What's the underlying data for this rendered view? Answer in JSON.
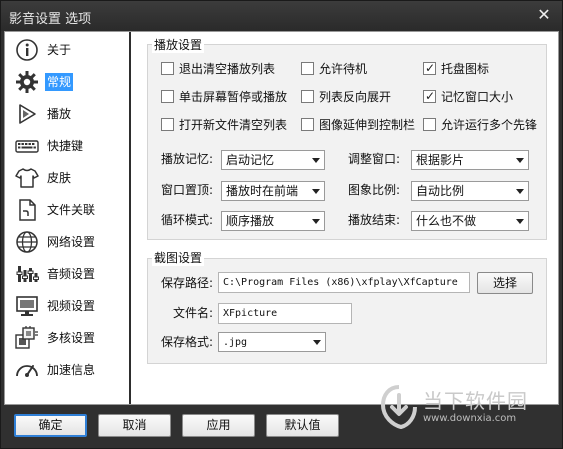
{
  "window": {
    "title": "影音设置 选项",
    "close_glyph": "✕"
  },
  "sidebar": {
    "items": [
      {
        "label": "关于",
        "icon": "info-icon",
        "selected": false
      },
      {
        "label": "常规",
        "icon": "gear-icon",
        "selected": true
      },
      {
        "label": "播放",
        "icon": "play-icon",
        "selected": false
      },
      {
        "label": "快捷键",
        "icon": "keyboard-icon",
        "selected": false
      },
      {
        "label": "皮肤",
        "icon": "shirt-icon",
        "selected": false
      },
      {
        "label": "文件关联",
        "icon": "file-icon",
        "selected": false
      },
      {
        "label": "网络设置",
        "icon": "globe-icon",
        "selected": false
      },
      {
        "label": "音频设置",
        "icon": "audio-icon",
        "selected": false
      },
      {
        "label": "视频设置",
        "icon": "monitor-icon",
        "selected": false
      },
      {
        "label": "多核设置",
        "icon": "cpu-icon",
        "selected": false
      },
      {
        "label": "加速信息",
        "icon": "speedometer-icon",
        "selected": false
      }
    ]
  },
  "playback": {
    "title": "播放设置",
    "checkboxes": [
      {
        "label": "退出清空播放列表",
        "checked": false
      },
      {
        "label": "允许待机",
        "checked": false
      },
      {
        "label": "托盘图标",
        "checked": true
      },
      {
        "label": "单击屏幕暂停或播放",
        "checked": false
      },
      {
        "label": "列表反向展开",
        "checked": false
      },
      {
        "label": "记忆窗口大小",
        "checked": true
      },
      {
        "label": "打开新文件清空列表",
        "checked": false
      },
      {
        "label": "图像延伸到控制栏",
        "checked": false
      },
      {
        "label": "允许运行多个先锋",
        "checked": false
      }
    ],
    "selects": [
      {
        "label": "播放记忆:",
        "value": "启动记忆"
      },
      {
        "label": "调整窗口:",
        "value": "根据影片"
      },
      {
        "label": "窗口置顶:",
        "value": "播放时在前端"
      },
      {
        "label": "图象比例:",
        "value": "自动比例"
      },
      {
        "label": "循环模式:",
        "value": "顺序播放"
      },
      {
        "label": "播放结束:",
        "value": "什么也不做"
      }
    ]
  },
  "capture": {
    "title": "截图设置",
    "path_label": "保存路径:",
    "path_value": "C:\\Program Files (x86)\\xfplay\\XfCapture",
    "browse_label": "选择",
    "filename_label": "文件名:",
    "filename_value": "XFpicture",
    "format_label": "保存格式:",
    "format_value": ".jpg"
  },
  "buttons": {
    "ok": "确定",
    "cancel": "取消",
    "apply": "应用",
    "default": "默认值"
  },
  "watermark": {
    "title": "当下软件园",
    "url": "www.downxia.com"
  },
  "colors": {
    "selection": "#3399ff",
    "title_bar": "#303030",
    "ok_border": "#2f7fd6"
  }
}
